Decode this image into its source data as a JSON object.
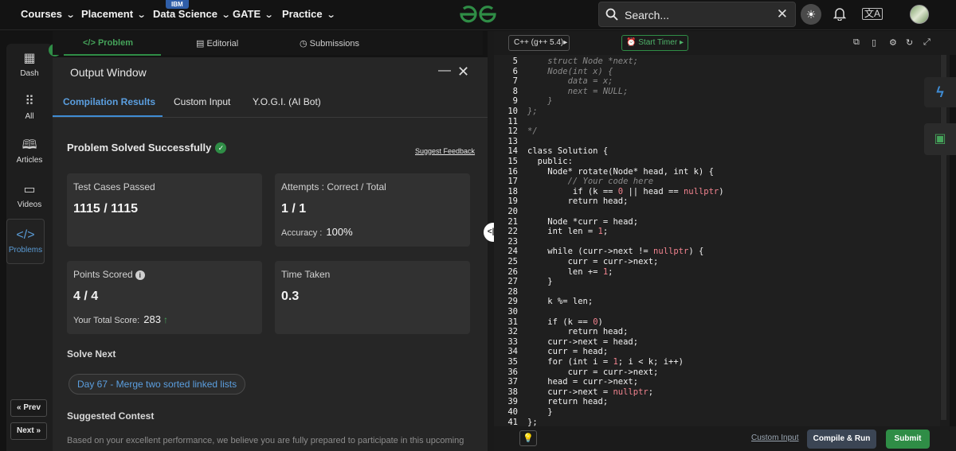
{
  "nav": {
    "items": [
      {
        "label": "Courses"
      },
      {
        "label": "Placement"
      },
      {
        "label": "Data Science",
        "badge": "IBM"
      },
      {
        "label": "GATE"
      },
      {
        "label": "Practice"
      }
    ],
    "search_placeholder": "Search...",
    "lang_icon": "文A"
  },
  "sidebar": {
    "items": [
      {
        "label": "Dash",
        "icon": "dashboard-icon"
      },
      {
        "label": "All",
        "icon": "grid-icon"
      },
      {
        "label": "Articles",
        "icon": "book-icon"
      },
      {
        "label": "Videos",
        "icon": "video-icon"
      },
      {
        "label": "Problems",
        "icon": "code-icon",
        "active": true
      }
    ],
    "prev_label": "Prev",
    "next_label": "Next"
  },
  "problem_tabs": {
    "problem": "Problem",
    "editorial": "Editorial",
    "submissions": "Submissions"
  },
  "output": {
    "title": "Output Window",
    "tabs": [
      "Compilation Results",
      "Custom Input",
      "Y.O.G.I. (AI Bot)"
    ],
    "status": "Problem Solved Successfully",
    "feedback": "Suggest Feedback",
    "cards": {
      "tests_label": "Test Cases Passed",
      "tests_value": "1115 / 1115",
      "attempts_label": "Attempts : Correct / Total",
      "attempts_value": "1 / 1",
      "accuracy_label": "Accuracy :",
      "accuracy_value": "100%",
      "points_label": "Points Scored",
      "points_value": "4 / 4",
      "total_label": "Your Total Score:",
      "total_value": "283",
      "time_label": "Time Taken",
      "time_value": "0.3"
    },
    "solve_next_label": "Solve Next",
    "next_problem": "Day 67 - Merge two sorted linked lists",
    "contest_label": "Suggested Contest",
    "contest_text": "Based on your excellent performance, we believe you are fully prepared to participate in this upcoming"
  },
  "editor": {
    "language": "C++ (g++ 5.4)",
    "timer": "Start Timer",
    "lines": [
      {
        "n": "5",
        "code": "    struct Node *next;",
        "kind": "comment"
      },
      {
        "n": "6",
        "code": "    Node(int x) {",
        "kind": "comment"
      },
      {
        "n": "7",
        "code": "        data = x;",
        "kind": "comment"
      },
      {
        "n": "8",
        "code": "        next = NULL;",
        "kind": "comment"
      },
      {
        "n": "9",
        "code": "    }",
        "kind": "comment"
      },
      {
        "n": "10",
        "code": "};",
        "kind": "comment"
      },
      {
        "n": "11",
        "code": "",
        "kind": "comment"
      },
      {
        "n": "12",
        "code": "*/",
        "kind": "comment"
      },
      {
        "n": "13",
        "code": "",
        "kind": "code"
      },
      {
        "n": "14",
        "code": "class Solution {",
        "kind": "code"
      },
      {
        "n": "15",
        "code": "  public:",
        "kind": "code"
      },
      {
        "n": "16",
        "code": "    Node* rotate(Node* head, int k) {",
        "kind": "code"
      },
      {
        "n": "17",
        "code": "        // Your code here",
        "kind": "comment"
      },
      {
        "n": "18",
        "code": "         if (k == 0 || head == nullptr)",
        "kind": "code"
      },
      {
        "n": "19",
        "code": "        return head;",
        "kind": "code"
      },
      {
        "n": "20",
        "code": "",
        "kind": "code"
      },
      {
        "n": "21",
        "code": "    Node *curr = head;",
        "kind": "code"
      },
      {
        "n": "22",
        "code": "    int len = 1;",
        "kind": "code"
      },
      {
        "n": "23",
        "code": "",
        "kind": "code"
      },
      {
        "n": "24",
        "code": "    while (curr->next != nullptr) {",
        "kind": "code"
      },
      {
        "n": "25",
        "code": "        curr = curr->next;",
        "kind": "code"
      },
      {
        "n": "26",
        "code": "        len += 1;",
        "kind": "code"
      },
      {
        "n": "27",
        "code": "    }",
        "kind": "code"
      },
      {
        "n": "28",
        "code": "",
        "kind": "code"
      },
      {
        "n": "29",
        "code": "    k %= len;",
        "kind": "code"
      },
      {
        "n": "30",
        "code": "",
        "kind": "code"
      },
      {
        "n": "31",
        "code": "    if (k == 0)",
        "kind": "code"
      },
      {
        "n": "32",
        "code": "        return head;",
        "kind": "code"
      },
      {
        "n": "33",
        "code": "    curr->next = head;",
        "kind": "code"
      },
      {
        "n": "34",
        "code": "    curr = head;",
        "kind": "code"
      },
      {
        "n": "35",
        "code": "    for (int i = 1; i < k; i++)",
        "kind": "code"
      },
      {
        "n": "36",
        "code": "        curr = curr->next;",
        "kind": "code"
      },
      {
        "n": "37",
        "code": "    head = curr->next;",
        "kind": "code"
      },
      {
        "n": "38",
        "code": "    curr->next = nullptr;",
        "kind": "code"
      },
      {
        "n": "39",
        "code": "    return head;",
        "kind": "code"
      },
      {
        "n": "40",
        "code": "    }",
        "kind": "code"
      },
      {
        "n": "41",
        "code": "};",
        "kind": "code"
      }
    ]
  },
  "footer": {
    "custom_input": "Custom Input",
    "compile": "Compile & Run",
    "submit": "Submit"
  },
  "colors": {
    "brand_green": "#2f8d46",
    "link_blue": "#5b9fe0",
    "number_red": "#f2838f"
  }
}
